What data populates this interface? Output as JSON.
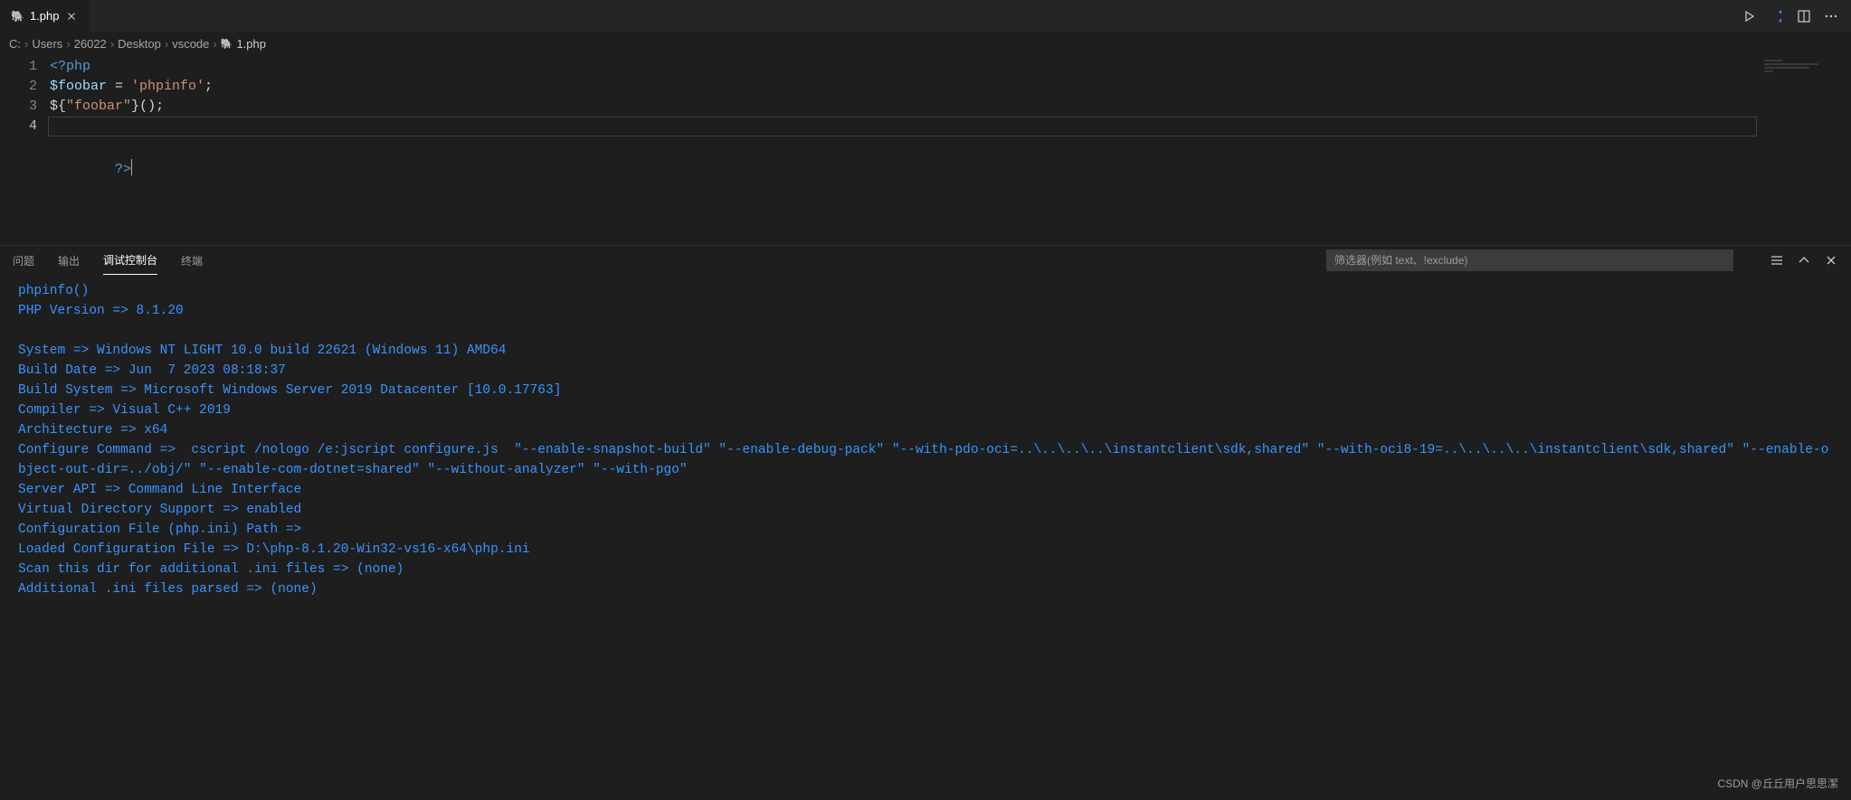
{
  "tab": {
    "filename": "1.php",
    "icon": "php-file-icon"
  },
  "breadcrumbs": {
    "segments": [
      "C:",
      "Users",
      "26022",
      "Desktop",
      "vscode"
    ],
    "file": "1.php"
  },
  "editor": {
    "lines": {
      "l1": {
        "num": "1"
      },
      "l2": {
        "num": "2"
      },
      "l3": {
        "num": "3"
      },
      "l4": {
        "num": "4"
      }
    },
    "tokens": {
      "open_tag": "<?php",
      "var_foobar": "$foobar",
      "eq": " = ",
      "str_phpinfo": "'phpinfo'",
      "semi": ";",
      "dollar_open": "$",
      "brace_open": "{",
      "str_foobar": "\"foobar\"",
      "brace_close": "}",
      "paren_open": "(",
      "paren_close": ")",
      "close_tag": "?>"
    }
  },
  "panel": {
    "tabs": {
      "problems": "问题",
      "output": "输出",
      "debug": "调试控制台",
      "terminal": "终端"
    },
    "filter_placeholder": "筛选器(例如 text、!exclude)"
  },
  "debug_output": [
    "phpinfo()",
    "PHP Version => 8.1.20",
    "",
    "System => Windows NT LIGHT 10.0 build 22621 (Windows 11) AMD64",
    "Build Date => Jun  7 2023 08:18:37",
    "Build System => Microsoft Windows Server 2019 Datacenter [10.0.17763]",
    "Compiler => Visual C++ 2019",
    "Architecture => x64",
    "Configure Command =>  cscript /nologo /e:jscript configure.js  \"--enable-snapshot-build\" \"--enable-debug-pack\" \"--with-pdo-oci=..\\..\\..\\..\\instantclient\\sdk,shared\" \"--with-oci8-19=..\\..\\..\\..\\instantclient\\sdk,shared\" \"--enable-object-out-dir=../obj/\" \"--enable-com-dotnet=shared\" \"--without-analyzer\" \"--with-pgo\"",
    "Server API => Command Line Interface",
    "Virtual Directory Support => enabled",
    "Configuration File (php.ini) Path =>",
    "Loaded Configuration File => D:\\php-8.1.20-Win32-vs16-x64\\php.ini",
    "Scan this dir for additional .ini files => (none)",
    "Additional .ini files parsed => (none)"
  ],
  "watermark": "CSDN @丘丘用户思思潔"
}
